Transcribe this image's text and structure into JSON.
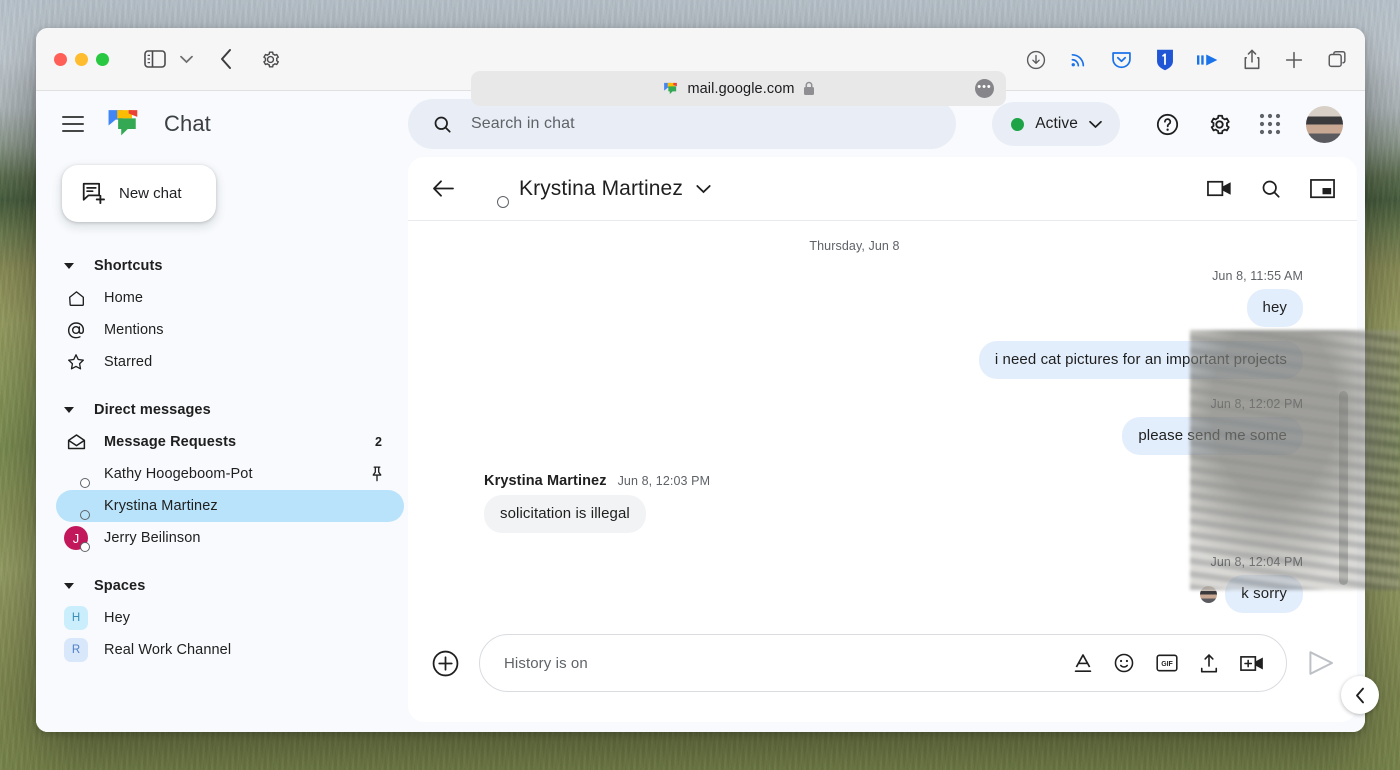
{
  "browser": {
    "url": "mail.google.com",
    "lock_icon": "lock-icon",
    "site_icon": "google-chat-favicon",
    "more_label": "•••",
    "toolbar_icons": [
      {
        "name": "downloads-icon"
      },
      {
        "name": "rss-feed-icon"
      },
      {
        "name": "pocket-icon"
      },
      {
        "name": "1password-icon"
      },
      {
        "name": "media-forward-icon"
      },
      {
        "name": "share-icon"
      },
      {
        "name": "new-tab-icon"
      },
      {
        "name": "tab-overview-icon"
      }
    ],
    "window_controls": [
      "close",
      "minimize",
      "maximize"
    ]
  },
  "app": {
    "title": "Chat",
    "new_chat_label": "New chat",
    "search_placeholder": "Search in chat",
    "status": {
      "label": "Active",
      "color": "#1ea446"
    },
    "header_icons": [
      {
        "name": "help-icon"
      },
      {
        "name": "settings-gear-icon"
      },
      {
        "name": "google-apps-grid-icon"
      },
      {
        "name": "account-avatar"
      }
    ]
  },
  "sidebar": {
    "sections": [
      {
        "name": "Shortcuts",
        "items": [
          {
            "label": "Home",
            "icon": "home-icon"
          },
          {
            "label": "Mentions",
            "icon": "mention-at-icon"
          },
          {
            "label": "Starred",
            "icon": "star-icon"
          }
        ]
      },
      {
        "name": "Direct messages",
        "items": [
          {
            "label": "Message Requests",
            "icon": "envelope-icon",
            "badge": "2",
            "bold": true
          },
          {
            "label": "Kathy Hoogeboom-Pot",
            "icon": "avatar-landscape",
            "pin": "pin-icon"
          },
          {
            "label": "Krystina Martinez",
            "icon": "avatar-person",
            "selected": true
          },
          {
            "label": "Jerry Beilinson",
            "icon": "avatar-letter",
            "letter": "J",
            "color": "#c2185b"
          }
        ]
      },
      {
        "name": "Spaces",
        "items": [
          {
            "label": "Hey",
            "icon": "space-icon",
            "letter": "H"
          },
          {
            "label": "Real Work Channel",
            "icon": "space-icon",
            "letter": "R"
          }
        ]
      }
    ]
  },
  "conversation": {
    "title": "Krystina Martinez",
    "back_icon": "back-arrow-icon",
    "dropdown_icon": "chevron-down-icon",
    "actions": [
      {
        "name": "video-call-icon"
      },
      {
        "name": "search-icon"
      },
      {
        "name": "open-in-pip-icon"
      }
    ],
    "day_separator": "Thursday, Jun 8",
    "messages": [
      {
        "direction": "out",
        "time": "Jun 8, 11:55 AM",
        "text": "hey"
      },
      {
        "direction": "out",
        "time": "",
        "text": "i need cat pictures for an important projects"
      },
      {
        "direction": "out",
        "time": "Jun 8, 12:02 PM",
        "text": "please send me some"
      },
      {
        "direction": "in",
        "sender": "Krystina Martinez",
        "time": "Jun 8, 12:03 PM",
        "text": "solicitation is illegal"
      },
      {
        "direction": "out",
        "time": "Jun 8, 12:04 PM",
        "text": "k sorry",
        "read_receipt": true
      }
    ],
    "composer": {
      "placeholder": "History is on",
      "add_icon": "add-circle-icon",
      "icons": [
        {
          "name": "format-text-icon"
        },
        {
          "name": "emoji-icon"
        },
        {
          "name": "gif-icon"
        },
        {
          "name": "upload-file-icon"
        },
        {
          "name": "add-video-icon"
        }
      ],
      "send_icon": "send-icon"
    },
    "panel_toggle_icon": "chevron-left-icon"
  }
}
